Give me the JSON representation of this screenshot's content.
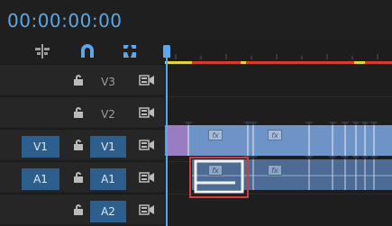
{
  "timecode": "00:00:00:00",
  "toolbar": {
    "tools": [
      {
        "name": "insert-and-overwrite-tool",
        "icon": "nest-sequence-icon"
      },
      {
        "name": "snap-tool",
        "icon": "magnet-icon"
      },
      {
        "name": "linked-selection-tool",
        "icon": "linked-selection-icon"
      }
    ]
  },
  "tracks": [
    {
      "id": "V3",
      "source": "",
      "label": "V3",
      "active": false
    },
    {
      "id": "V2",
      "source": "",
      "label": "V2",
      "active": false
    },
    {
      "id": "V1",
      "source": "V1",
      "label": "V1",
      "active": true
    },
    {
      "id": "A1",
      "source": "A1",
      "label": "A1",
      "active": true
    },
    {
      "id": "A2",
      "source": "",
      "label": "A2",
      "active": true
    }
  ],
  "clips": {
    "fx_label": "fx"
  },
  "colors": {
    "accent": "#5aa8e8",
    "track_target": "#2d5f8e",
    "video_clip": "#6e93c6",
    "audio_clip": "#4d6b95",
    "highlight": "#d43b3b",
    "render_bar_red": "#d93a2e",
    "render_bar_yellow": "#e3d23a"
  }
}
